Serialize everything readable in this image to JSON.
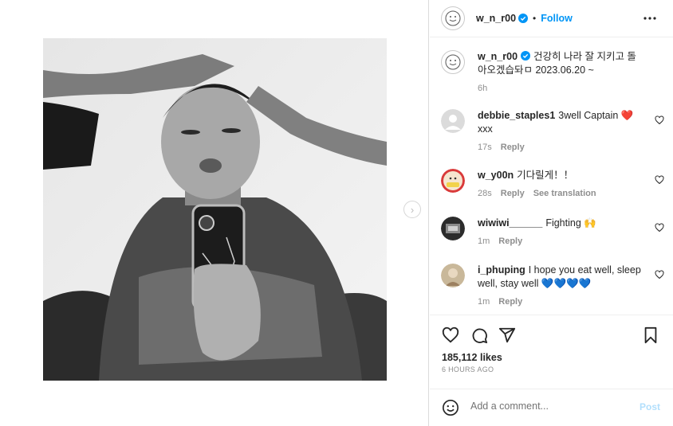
{
  "post": {
    "username": "w_n_r00",
    "follow_label": "Follow",
    "separator": "•",
    "caption": "건강히 나라 잘 지키고 돌아오겠습돠ㅁ 2023.06.20 ~",
    "caption_time": "6h"
  },
  "comments": [
    {
      "user": "debbie_staples1",
      "text": "3well Captain ❤️ xxx",
      "time": "17s",
      "reply": "Reply",
      "translate": ""
    },
    {
      "user": "w_y00n",
      "text": "기다릴게！！",
      "time": "28s",
      "reply": "Reply",
      "translate": "See translation"
    },
    {
      "user": "wiwiwi______",
      "text": "Fighting 🙌",
      "time": "1m",
      "reply": "Reply",
      "translate": ""
    },
    {
      "user": "i_phuping",
      "text": "I hope you eat well, sleep well, stay well 💙💙💙💙",
      "time": "1m",
      "reply": "Reply",
      "translate": ""
    }
  ],
  "stats": {
    "likes": "185,112 likes",
    "posted_ago": "6 HOURS AGO"
  },
  "composer": {
    "placeholder": "Add a comment...",
    "post_label": "Post"
  },
  "colors": {
    "accent": "#0095f6",
    "verified": "#0095f6",
    "muted": "#8e8e8e",
    "post_disabled": "#b2dffc"
  }
}
